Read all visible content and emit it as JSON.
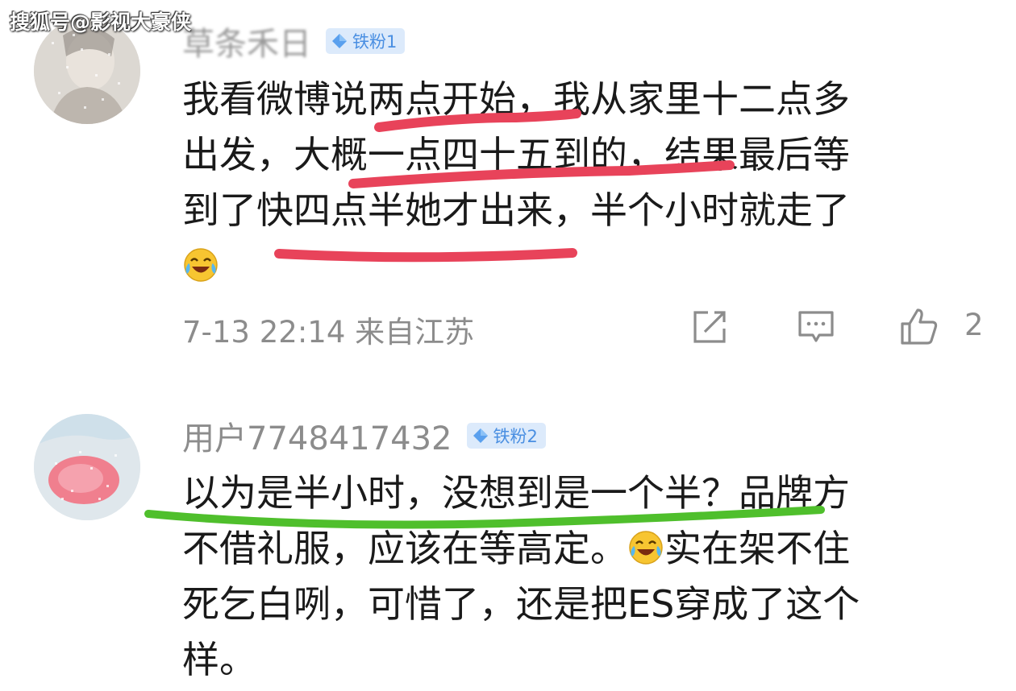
{
  "watermark": "搜狐号@影视大豪侠",
  "comments": [
    {
      "username": "草条禾日",
      "badge": "铁粉1",
      "lines": [
        "我看微博说两点开始，我从家里十二点多",
        "出发，大概一点四十五到的，结果最后等",
        "到了快四点半她才出来，半个小时就走了"
      ],
      "emoji": "laugh-cry-emoji",
      "date": "7-13 22:14",
      "location": "来自江苏",
      "likes": "2"
    },
    {
      "username": "用户7748417432",
      "badge": "铁粉2",
      "lines": [
        "以为是半小时，没想到是一个半？品牌方",
        "不借礼服，应该在等高定。",
        "实在架不住",
        "死乞白咧，可惜了，还是把ES穿成了这个",
        "样。"
      ],
      "emoji": "laugh-cry-emoji"
    }
  ],
  "colors": {
    "highlight_red": "#e8435a",
    "highlight_green": "#4fbf2c",
    "badge_bg": "#dceafb",
    "badge_text": "#4a8fe2",
    "meta_text": "#8c8c8c"
  },
  "icons": [
    "diamond-icon",
    "share-icon",
    "reply-icon",
    "like-icon",
    "laugh-cry-emoji"
  ]
}
